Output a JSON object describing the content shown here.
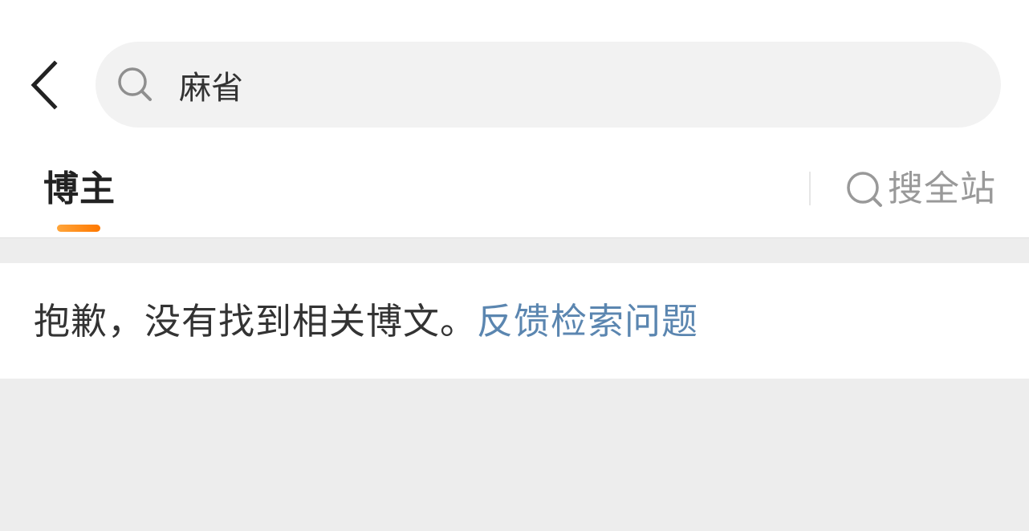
{
  "header": {
    "back_icon": "chevron-left-icon",
    "search": {
      "icon": "search-icon",
      "value": "麻省",
      "placeholder": ""
    }
  },
  "tabs": {
    "active_label": "博主",
    "accent_color": "#ff8a1c"
  },
  "search_all": {
    "icon": "search-icon",
    "label": "搜全站"
  },
  "message": {
    "text": "抱歉，没有找到相关博文。",
    "link_label": "反馈检索问题",
    "link_color": "#5b86b0"
  }
}
